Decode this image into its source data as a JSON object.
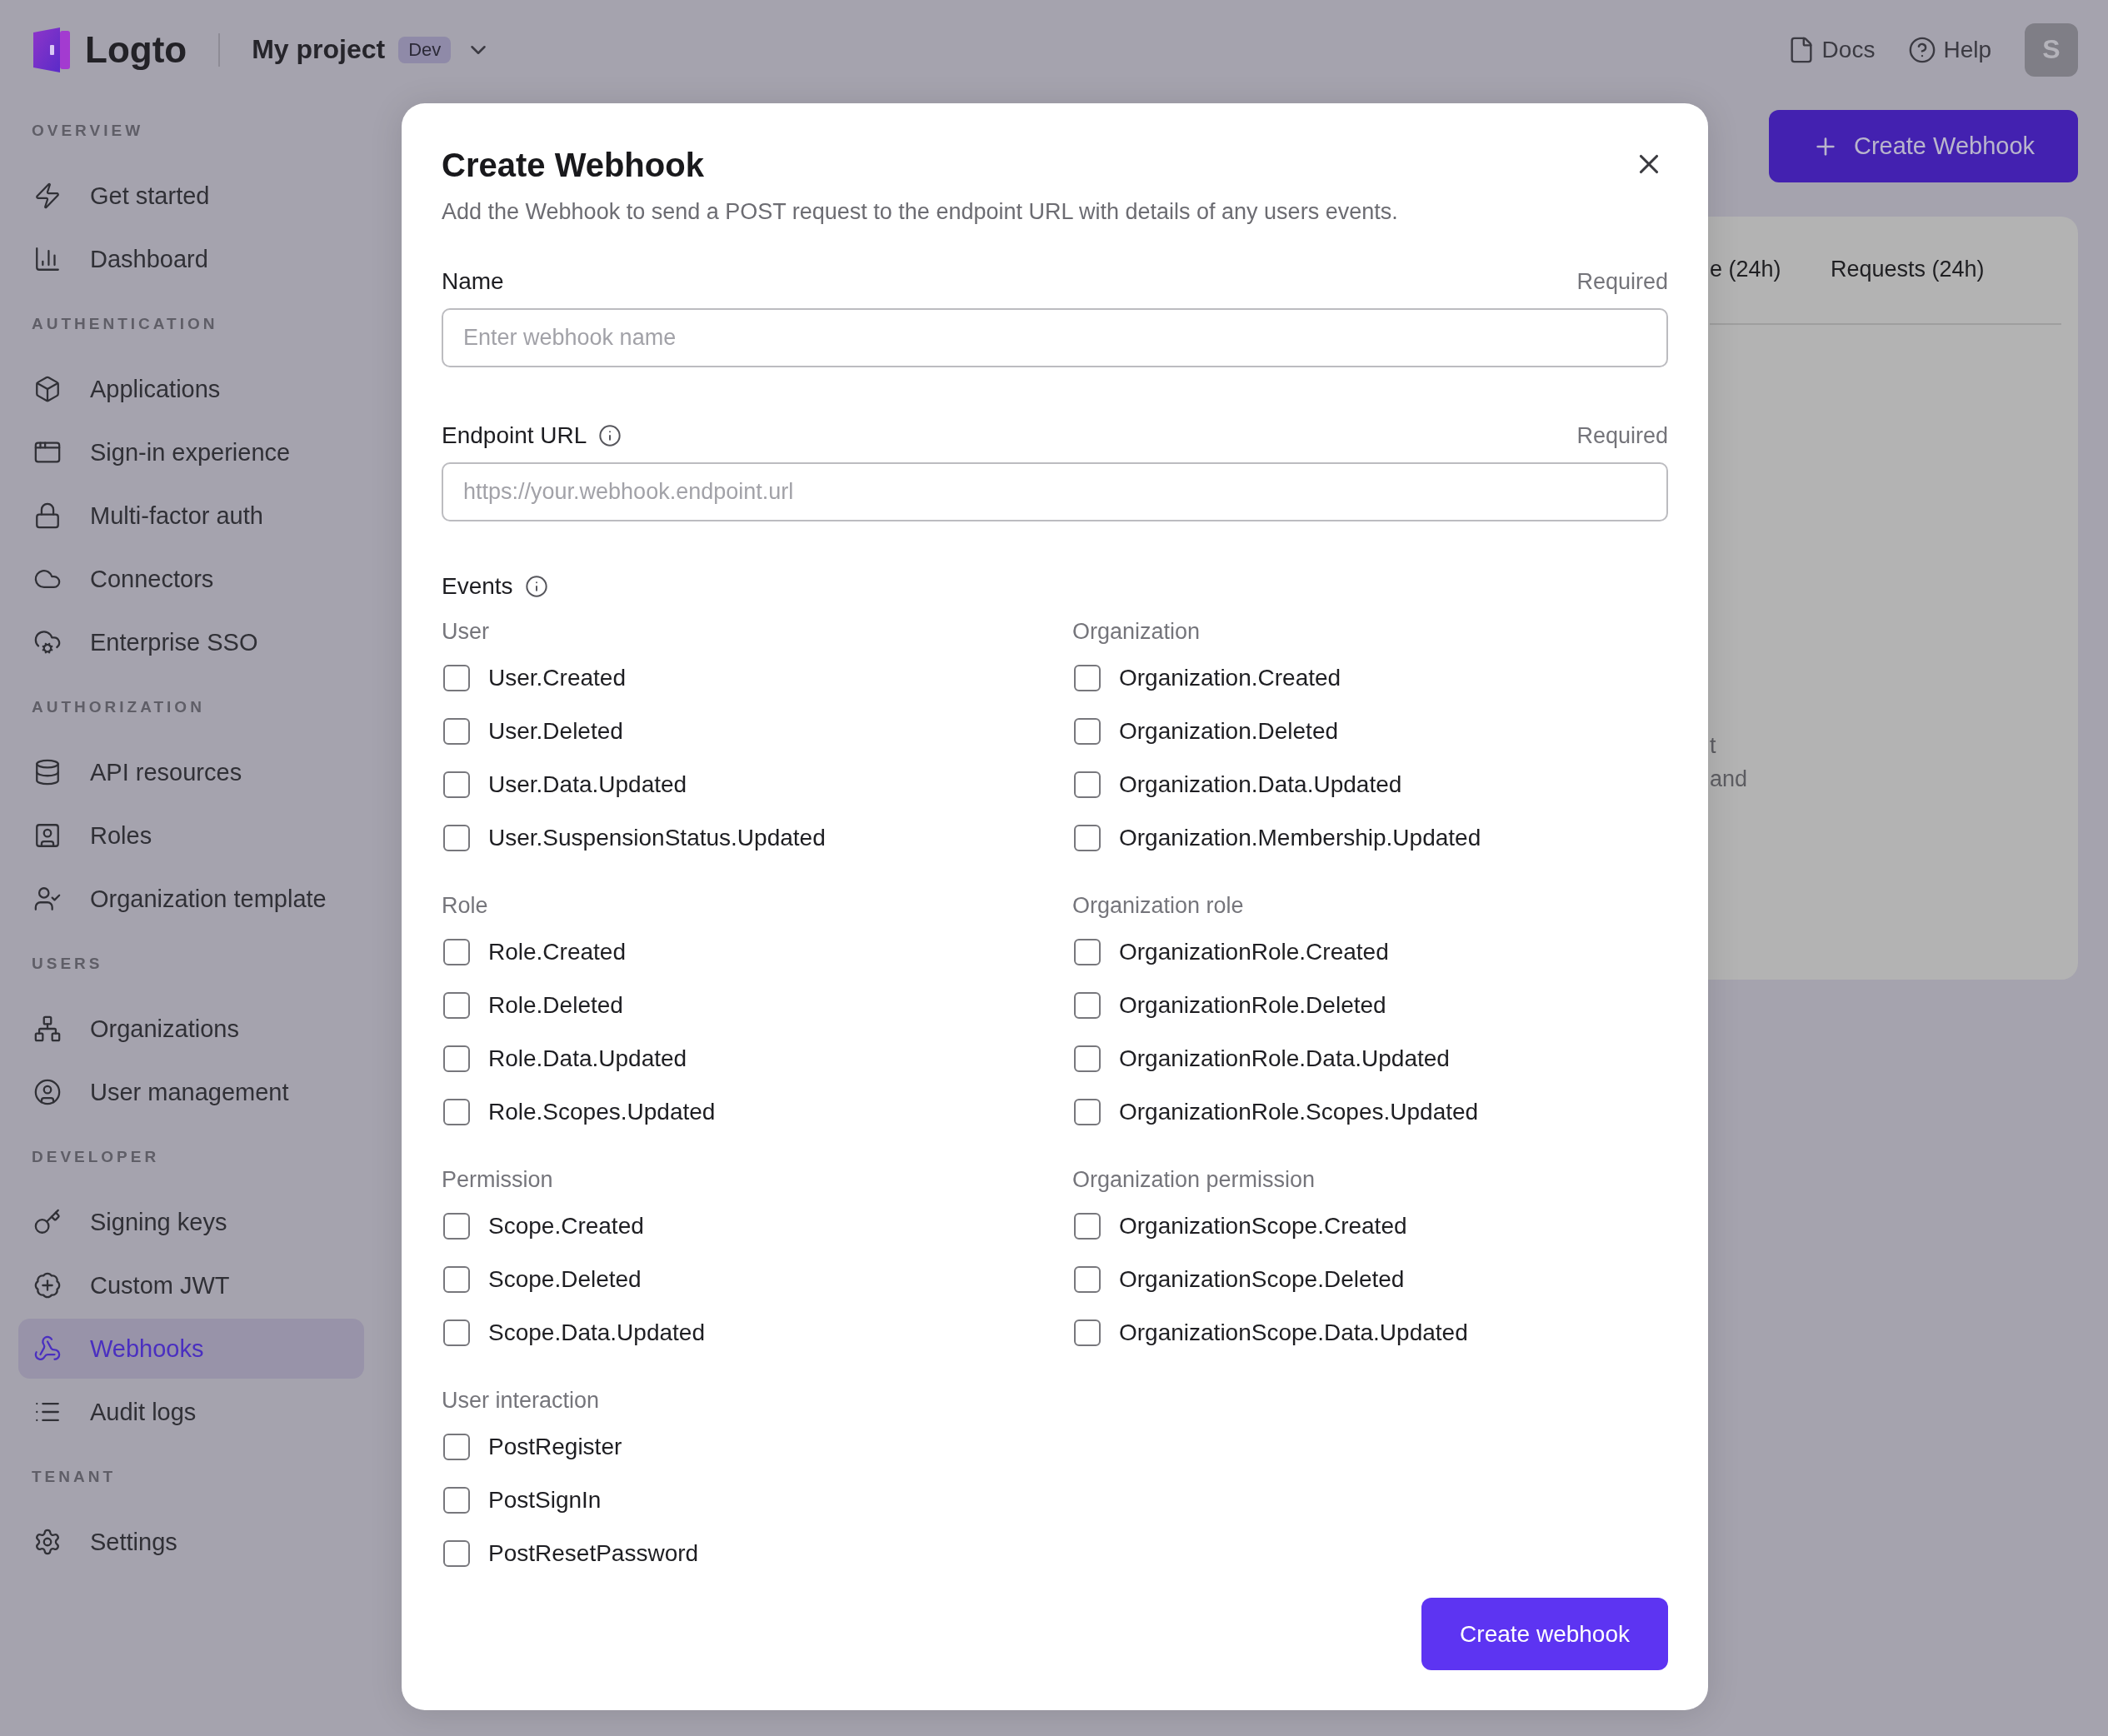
{
  "header": {
    "logo": "Logto",
    "project": "My project",
    "badge": "Dev",
    "links": [
      "Docs",
      "Help"
    ],
    "avatar": "S"
  },
  "sidebar": {
    "sections": [
      {
        "title": "OVERVIEW",
        "items": [
          {
            "label": "Get started",
            "selected": false
          },
          {
            "label": "Dashboard",
            "selected": false
          }
        ]
      },
      {
        "title": "AUTHENTICATION",
        "items": [
          {
            "label": "Applications",
            "selected": false
          },
          {
            "label": "Sign-in experience",
            "selected": false
          },
          {
            "label": "Multi-factor auth",
            "selected": false
          },
          {
            "label": "Connectors",
            "selected": false
          },
          {
            "label": "Enterprise SSO",
            "selected": false
          }
        ]
      },
      {
        "title": "AUTHORIZATION",
        "items": [
          {
            "label": "API resources",
            "selected": false
          },
          {
            "label": "Roles",
            "selected": false
          },
          {
            "label": "Organization template",
            "selected": false
          }
        ]
      },
      {
        "title": "USERS",
        "items": [
          {
            "label": "Organizations",
            "selected": false
          },
          {
            "label": "User management",
            "selected": false
          }
        ]
      },
      {
        "title": "DEVELOPER",
        "items": [
          {
            "label": "Signing keys",
            "selected": false
          },
          {
            "label": "Custom JWT",
            "selected": false
          },
          {
            "label": "Webhooks",
            "selected": true
          },
          {
            "label": "Audit logs",
            "selected": false
          }
        ]
      },
      {
        "title": "TENANT",
        "items": [
          {
            "label": "Settings",
            "selected": false
          }
        ]
      }
    ]
  },
  "background": {
    "create_button": "Create Webhook",
    "columns": [
      "e (24h)",
      "Requests (24h)"
    ],
    "empty_text": [
      "t",
      "and"
    ]
  },
  "modal": {
    "title": "Create Webhook",
    "description": "Add the Webhook to send a POST request to the endpoint URL with details of any users events.",
    "fields": [
      {
        "label": "Name",
        "info": false,
        "required": "Required",
        "placeholder": "Enter webhook name"
      },
      {
        "label": "Endpoint URL",
        "info": true,
        "required": "Required",
        "placeholder": "https://your.webhook.endpoint.url"
      }
    ],
    "events_label": "Events",
    "events_info": true,
    "groups": [
      {
        "title": "User",
        "events": [
          {
            "label": "User.Created",
            "checked": false
          },
          {
            "label": "User.Deleted",
            "checked": false
          },
          {
            "label": "User.Data.Updated",
            "checked": false
          },
          {
            "label": "User.SuspensionStatus.Updated",
            "checked": false
          }
        ]
      },
      {
        "title": "Organization",
        "events": [
          {
            "label": "Organization.Created",
            "checked": false
          },
          {
            "label": "Organization.Deleted",
            "checked": false
          },
          {
            "label": "Organization.Data.Updated",
            "checked": false
          },
          {
            "label": "Organization.Membership.Updated",
            "checked": false
          }
        ]
      },
      {
        "title": "Role",
        "events": [
          {
            "label": "Role.Created",
            "checked": false
          },
          {
            "label": "Role.Deleted",
            "checked": false
          },
          {
            "label": "Role.Data.Updated",
            "checked": false
          },
          {
            "label": "Role.Scopes.Updated",
            "checked": false
          }
        ]
      },
      {
        "title": "Organization role",
        "events": [
          {
            "label": "OrganizationRole.Created",
            "checked": false
          },
          {
            "label": "OrganizationRole.Deleted",
            "checked": false
          },
          {
            "label": "OrganizationRole.Data.Updated",
            "checked": false
          },
          {
            "label": "OrganizationRole.Scopes.Updated",
            "checked": false
          }
        ]
      },
      {
        "title": "Permission",
        "events": [
          {
            "label": "Scope.Created",
            "checked": false
          },
          {
            "label": "Scope.Deleted",
            "checked": false
          },
          {
            "label": "Scope.Data.Updated",
            "checked": false
          }
        ]
      },
      {
        "title": "Organization permission",
        "events": [
          {
            "label": "OrganizationScope.Created",
            "checked": false
          },
          {
            "label": "OrganizationScope.Deleted",
            "checked": false
          },
          {
            "label": "OrganizationScope.Data.Updated",
            "checked": false
          }
        ]
      },
      {
        "title": "User interaction",
        "events": [
          {
            "label": "PostRegister",
            "checked": false
          },
          {
            "label": "PostSignIn",
            "checked": false
          },
          {
            "label": "PostResetPassword",
            "checked": false
          }
        ]
      }
    ],
    "submit": "Create webhook"
  }
}
